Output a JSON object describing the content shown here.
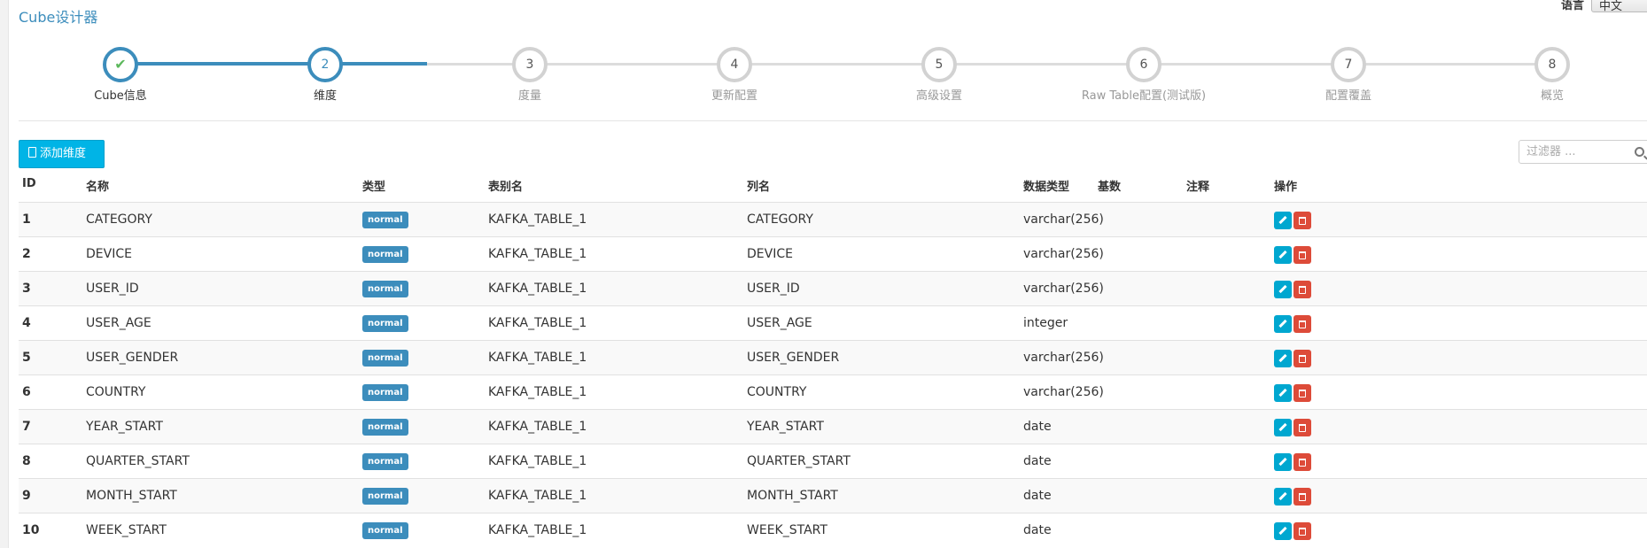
{
  "app": {
    "title": "Cube设计器"
  },
  "language": {
    "label": "语言",
    "selected": "中文"
  },
  "steps": [
    {
      "num": "✔",
      "label": "Cube信息",
      "state": "done"
    },
    {
      "num": "2",
      "label": "维度",
      "state": "active"
    },
    {
      "num": "3",
      "label": "度量",
      "state": "todo"
    },
    {
      "num": "4",
      "label": "更新配置",
      "state": "todo"
    },
    {
      "num": "5",
      "label": "高级设置",
      "state": "todo"
    },
    {
      "num": "6",
      "label": "Raw Table配置(测试版)",
      "state": "todo"
    },
    {
      "num": "7",
      "label": "配置覆盖",
      "state": "todo"
    },
    {
      "num": "8",
      "label": "概览",
      "state": "todo"
    }
  ],
  "toolbar": {
    "add_dimension": "添加维度",
    "filter_placeholder": "过滤器 ..."
  },
  "table": {
    "headers": {
      "id": "ID",
      "name": "名称",
      "type": "类型",
      "table_alias": "表别名",
      "column": "列名",
      "datatype": "数据类型",
      "cardinality": "基数",
      "comment": "注释",
      "actions": "操作"
    },
    "rows": [
      {
        "id": "1",
        "name": "CATEGORY",
        "type": "normal",
        "table": "KAFKA_TABLE_1",
        "column": "CATEGORY",
        "datatype": "varchar(256)"
      },
      {
        "id": "2",
        "name": "DEVICE",
        "type": "normal",
        "table": "KAFKA_TABLE_1",
        "column": "DEVICE",
        "datatype": "varchar(256)"
      },
      {
        "id": "3",
        "name": "USER_ID",
        "type": "normal",
        "table": "KAFKA_TABLE_1",
        "column": "USER_ID",
        "datatype": "varchar(256)"
      },
      {
        "id": "4",
        "name": "USER_AGE",
        "type": "normal",
        "table": "KAFKA_TABLE_1",
        "column": "USER_AGE",
        "datatype": "integer"
      },
      {
        "id": "5",
        "name": "USER_GENDER",
        "type": "normal",
        "table": "KAFKA_TABLE_1",
        "column": "USER_GENDER",
        "datatype": "varchar(256)"
      },
      {
        "id": "6",
        "name": "COUNTRY",
        "type": "normal",
        "table": "KAFKA_TABLE_1",
        "column": "COUNTRY",
        "datatype": "varchar(256)"
      },
      {
        "id": "7",
        "name": "YEAR_START",
        "type": "normal",
        "table": "KAFKA_TABLE_1",
        "column": "YEAR_START",
        "datatype": "date"
      },
      {
        "id": "8",
        "name": "QUARTER_START",
        "type": "normal",
        "table": "KAFKA_TABLE_1",
        "column": "QUARTER_START",
        "datatype": "date"
      },
      {
        "id": "9",
        "name": "MONTH_START",
        "type": "normal",
        "table": "KAFKA_TABLE_1",
        "column": "MONTH_START",
        "datatype": "date"
      },
      {
        "id": "10",
        "name": "WEEK_START",
        "type": "normal",
        "table": "KAFKA_TABLE_1",
        "column": "WEEK_START",
        "datatype": "date"
      }
    ]
  },
  "colors": {
    "primary": "#3c8dbc",
    "add_button": "#00b4e6",
    "edit": "#00a7d0",
    "delete": "#dd4b39",
    "done_check": "#5cb85c"
  },
  "icons": {
    "add": "add-icon",
    "search": "search-icon",
    "edit": "pencil-icon",
    "delete": "trash-icon",
    "done": "check-icon"
  }
}
